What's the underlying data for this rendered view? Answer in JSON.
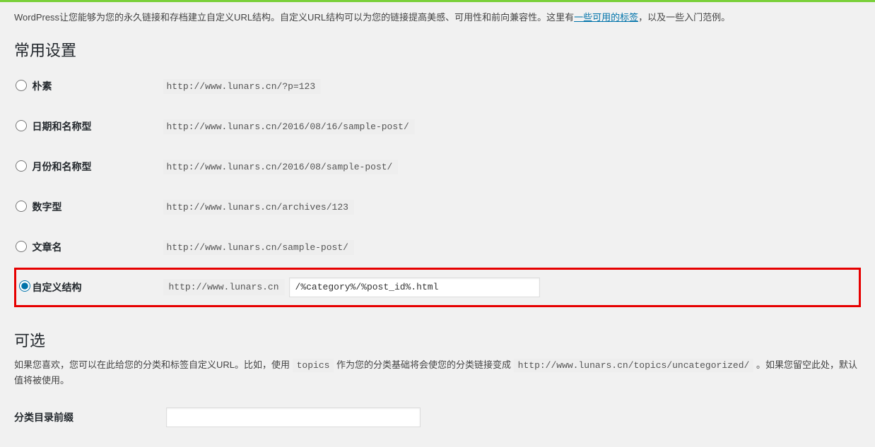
{
  "description": {
    "prefix": "WordPress让您能够为您的永久链接和存档建立自定义URL结构。自定义URL结构可以为您的链接提高美感、可用性和前向兼容性。这里有",
    "link_text": "一些可用的标签",
    "suffix": "，以及一些入门范例。"
  },
  "common_heading": "常用设置",
  "options": [
    {
      "label": "朴素",
      "example": "http://www.lunars.cn/?p=123",
      "selected": false
    },
    {
      "label": "日期和名称型",
      "example": "http://www.lunars.cn/2016/08/16/sample-post/",
      "selected": false
    },
    {
      "label": "月份和名称型",
      "example": "http://www.lunars.cn/2016/08/sample-post/",
      "selected": false
    },
    {
      "label": "数字型",
      "example": "http://www.lunars.cn/archives/123",
      "selected": false
    },
    {
      "label": "文章名",
      "example": "http://www.lunars.cn/sample-post/",
      "selected": false
    }
  ],
  "custom": {
    "label": "自定义结构",
    "base_url": "http://www.lunars.cn",
    "value": "/%category%/%post_id%.html",
    "selected": true
  },
  "optional_heading": "可选",
  "optional_desc": {
    "part1": "如果您喜欢，您可以在此给您的分类和标签自定义URL。比如，使用 ",
    "code1": "topics",
    "part2": " 作为您的分类基础将会使您的分类链接变成 ",
    "code2": "http://www.lunars.cn/topics/uncategorized/",
    "part3": " 。如果您留空此处，默认值将被使用。"
  },
  "category_prefix_label": "分类目录前缀"
}
